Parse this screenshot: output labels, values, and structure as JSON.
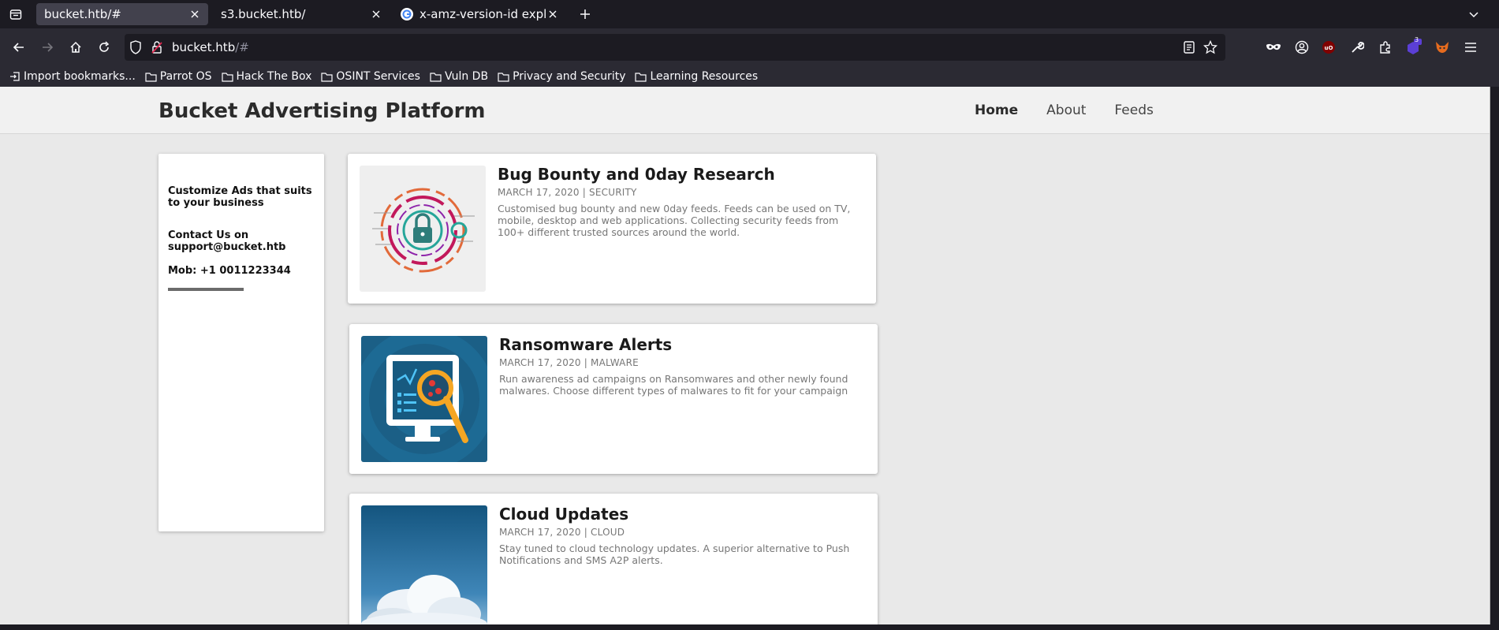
{
  "browser": {
    "tabs": [
      {
        "title": "bucket.htb/#",
        "active": true
      },
      {
        "title": "s3.bucket.htb/",
        "active": false
      },
      {
        "title": "x-amz-version-id exploit",
        "active": false
      }
    ],
    "url": {
      "host": "bucket.htb",
      "suffix": "/#"
    },
    "toolbar_badge": "3",
    "bookmarks": [
      {
        "label": "Import bookmarks...",
        "icon": "import-icon"
      },
      {
        "label": "Parrot OS",
        "icon": "folder-icon"
      },
      {
        "label": "Hack The Box",
        "icon": "folder-icon"
      },
      {
        "label": "OSINT Services",
        "icon": "folder-icon"
      },
      {
        "label": "Vuln DB",
        "icon": "folder-icon"
      },
      {
        "label": "Privacy and Security",
        "icon": "folder-icon"
      },
      {
        "label": "Learning Resources",
        "icon": "folder-icon"
      }
    ]
  },
  "site": {
    "title": "Bucket Advertising Platform",
    "nav": [
      "Home",
      "About",
      "Feeds"
    ],
    "sidebar": {
      "line1": "Customize Ads that suits to your business",
      "line2": "Contact Us on support@bucket.htb",
      "line3": "Mob: +1 0011223344"
    },
    "posts": [
      {
        "title": "Bug Bounty and 0day Research",
        "meta": "MARCH 17, 2020 | SECURITY",
        "desc": "Customised bug bounty and new 0day feeds. Feeds can be used on TV, mobile, desktop and web applications. Collecting security feeds from 100+ different trusted sources around the world.",
        "image": "security-lock-image"
      },
      {
        "title": "Ransomware Alerts",
        "meta": "MARCH 17, 2020 | MALWARE",
        "desc": "Run awareness ad campaigns on Ransomwares and other newly found malwares. Choose different types of malwares to fit for your campaign",
        "image": "malware-scan-image"
      },
      {
        "title": "Cloud Updates",
        "meta": "MARCH 17, 2020 | CLOUD",
        "desc": "Stay tuned to cloud technology updates. A superior alternative to Push Notifications and SMS A2P alerts.",
        "image": "cloud-sky-image"
      }
    ]
  },
  "colors": {
    "chrome_dark": "#1c1b22",
    "chrome_toolbar": "#2b2a33",
    "page_bg": "#e9e9e9"
  }
}
